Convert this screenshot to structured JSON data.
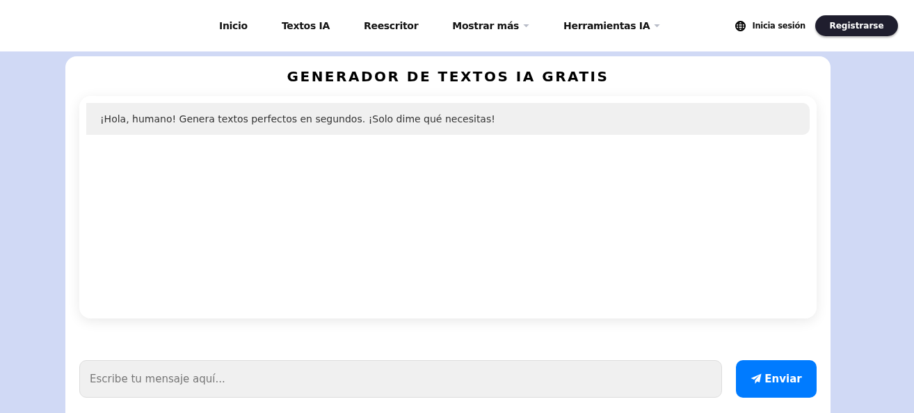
{
  "nav": [
    {
      "label": "Inicio",
      "kind": "link"
    },
    {
      "label": "Textos IA",
      "kind": "link"
    },
    {
      "label": "Reescritor",
      "kind": "link"
    },
    {
      "label": "Mostrar más",
      "kind": "dropdown"
    },
    {
      "label": "Herramientas IA",
      "kind": "dropdown"
    }
  ],
  "login": "Inicia sesión",
  "register": "Registrarse",
  "title": "GENERADOR DE TEXTOS IA GRATIS",
  "messages": [
    "¡Hola, humano! Genera textos perfectos en segundos. ¡Solo dime qué necesitas!"
  ],
  "input": {
    "placeholder": "Escribe tu mensaje aquí..."
  },
  "send": "Enviar"
}
